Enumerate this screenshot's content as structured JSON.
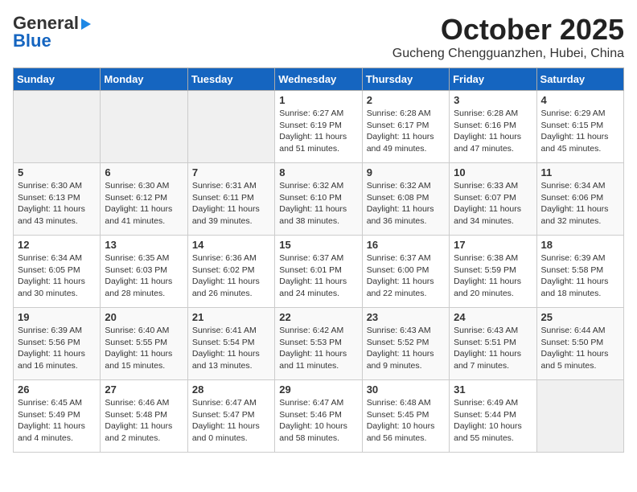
{
  "header": {
    "logo_general": "General",
    "logo_blue": "Blue",
    "title": "October 2025",
    "subtitle": "Gucheng Chengguanzhen, Hubei, China"
  },
  "days_of_week": [
    "Sunday",
    "Monday",
    "Tuesday",
    "Wednesday",
    "Thursday",
    "Friday",
    "Saturday"
  ],
  "weeks": [
    [
      {
        "day": "",
        "info": ""
      },
      {
        "day": "",
        "info": ""
      },
      {
        "day": "",
        "info": ""
      },
      {
        "day": "1",
        "info": "Sunrise: 6:27 AM\nSunset: 6:19 PM\nDaylight: 11 hours\nand 51 minutes."
      },
      {
        "day": "2",
        "info": "Sunrise: 6:28 AM\nSunset: 6:17 PM\nDaylight: 11 hours\nand 49 minutes."
      },
      {
        "day": "3",
        "info": "Sunrise: 6:28 AM\nSunset: 6:16 PM\nDaylight: 11 hours\nand 47 minutes."
      },
      {
        "day": "4",
        "info": "Sunrise: 6:29 AM\nSunset: 6:15 PM\nDaylight: 11 hours\nand 45 minutes."
      }
    ],
    [
      {
        "day": "5",
        "info": "Sunrise: 6:30 AM\nSunset: 6:13 PM\nDaylight: 11 hours\nand 43 minutes."
      },
      {
        "day": "6",
        "info": "Sunrise: 6:30 AM\nSunset: 6:12 PM\nDaylight: 11 hours\nand 41 minutes."
      },
      {
        "day": "7",
        "info": "Sunrise: 6:31 AM\nSunset: 6:11 PM\nDaylight: 11 hours\nand 39 minutes."
      },
      {
        "day": "8",
        "info": "Sunrise: 6:32 AM\nSunset: 6:10 PM\nDaylight: 11 hours\nand 38 minutes."
      },
      {
        "day": "9",
        "info": "Sunrise: 6:32 AM\nSunset: 6:08 PM\nDaylight: 11 hours\nand 36 minutes."
      },
      {
        "day": "10",
        "info": "Sunrise: 6:33 AM\nSunset: 6:07 PM\nDaylight: 11 hours\nand 34 minutes."
      },
      {
        "day": "11",
        "info": "Sunrise: 6:34 AM\nSunset: 6:06 PM\nDaylight: 11 hours\nand 32 minutes."
      }
    ],
    [
      {
        "day": "12",
        "info": "Sunrise: 6:34 AM\nSunset: 6:05 PM\nDaylight: 11 hours\nand 30 minutes."
      },
      {
        "day": "13",
        "info": "Sunrise: 6:35 AM\nSunset: 6:03 PM\nDaylight: 11 hours\nand 28 minutes."
      },
      {
        "day": "14",
        "info": "Sunrise: 6:36 AM\nSunset: 6:02 PM\nDaylight: 11 hours\nand 26 minutes."
      },
      {
        "day": "15",
        "info": "Sunrise: 6:37 AM\nSunset: 6:01 PM\nDaylight: 11 hours\nand 24 minutes."
      },
      {
        "day": "16",
        "info": "Sunrise: 6:37 AM\nSunset: 6:00 PM\nDaylight: 11 hours\nand 22 minutes."
      },
      {
        "day": "17",
        "info": "Sunrise: 6:38 AM\nSunset: 5:59 PM\nDaylight: 11 hours\nand 20 minutes."
      },
      {
        "day": "18",
        "info": "Sunrise: 6:39 AM\nSunset: 5:58 PM\nDaylight: 11 hours\nand 18 minutes."
      }
    ],
    [
      {
        "day": "19",
        "info": "Sunrise: 6:39 AM\nSunset: 5:56 PM\nDaylight: 11 hours\nand 16 minutes."
      },
      {
        "day": "20",
        "info": "Sunrise: 6:40 AM\nSunset: 5:55 PM\nDaylight: 11 hours\nand 15 minutes."
      },
      {
        "day": "21",
        "info": "Sunrise: 6:41 AM\nSunset: 5:54 PM\nDaylight: 11 hours\nand 13 minutes."
      },
      {
        "day": "22",
        "info": "Sunrise: 6:42 AM\nSunset: 5:53 PM\nDaylight: 11 hours\nand 11 minutes."
      },
      {
        "day": "23",
        "info": "Sunrise: 6:43 AM\nSunset: 5:52 PM\nDaylight: 11 hours\nand 9 minutes."
      },
      {
        "day": "24",
        "info": "Sunrise: 6:43 AM\nSunset: 5:51 PM\nDaylight: 11 hours\nand 7 minutes."
      },
      {
        "day": "25",
        "info": "Sunrise: 6:44 AM\nSunset: 5:50 PM\nDaylight: 11 hours\nand 5 minutes."
      }
    ],
    [
      {
        "day": "26",
        "info": "Sunrise: 6:45 AM\nSunset: 5:49 PM\nDaylight: 11 hours\nand 4 minutes."
      },
      {
        "day": "27",
        "info": "Sunrise: 6:46 AM\nSunset: 5:48 PM\nDaylight: 11 hours\nand 2 minutes."
      },
      {
        "day": "28",
        "info": "Sunrise: 6:47 AM\nSunset: 5:47 PM\nDaylight: 11 hours\nand 0 minutes."
      },
      {
        "day": "29",
        "info": "Sunrise: 6:47 AM\nSunset: 5:46 PM\nDaylight: 10 hours\nand 58 minutes."
      },
      {
        "day": "30",
        "info": "Sunrise: 6:48 AM\nSunset: 5:45 PM\nDaylight: 10 hours\nand 56 minutes."
      },
      {
        "day": "31",
        "info": "Sunrise: 6:49 AM\nSunset: 5:44 PM\nDaylight: 10 hours\nand 55 minutes."
      },
      {
        "day": "",
        "info": ""
      }
    ]
  ]
}
